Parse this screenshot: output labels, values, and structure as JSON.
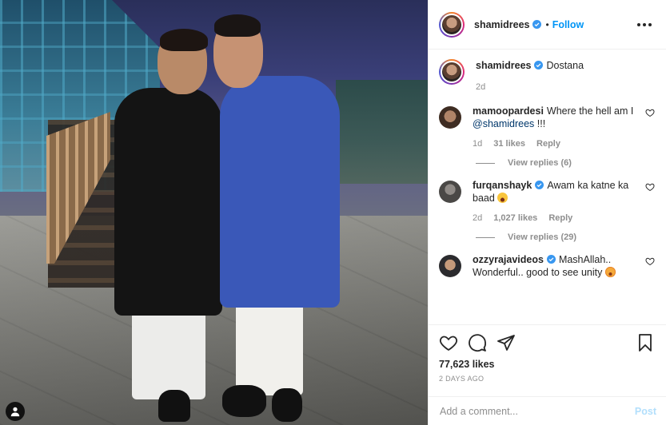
{
  "post": {
    "author": "shamidrees",
    "follow_label": "Follow",
    "caption": "Dostana",
    "caption_time": "2d",
    "likes": "77,623 likes",
    "posted_ago": "2 DAYS AGO"
  },
  "comments": [
    {
      "user": "mamoopardesi",
      "text_before": "Where the hell am I ",
      "mention": "@shamidrees",
      "text_after": " !!!",
      "time": "1d",
      "likes": "31 likes",
      "reply_label": "Reply",
      "view_replies": "View replies (6)",
      "verified": false
    },
    {
      "user": "furqanshayk",
      "text": "Awam ka katne ka baad",
      "emoji": "laughing-emoji",
      "time": "2d",
      "likes": "1,027 likes",
      "reply_label": "Reply",
      "view_replies": "View replies (29)",
      "verified": true
    },
    {
      "user": "ozzyrajavideos",
      "text": "MashAllah.. Wonderful.. good to see unity",
      "emoji": "smiling-face-with-hearts-emoji",
      "verified": true
    }
  ],
  "add_comment": {
    "placeholder": "Add a comment...",
    "post_label": "Post"
  },
  "colors": {
    "link": "#0095f6",
    "mention": "#00376b",
    "muted": "#8e8e8e",
    "post_disabled": "#b2dffc"
  }
}
